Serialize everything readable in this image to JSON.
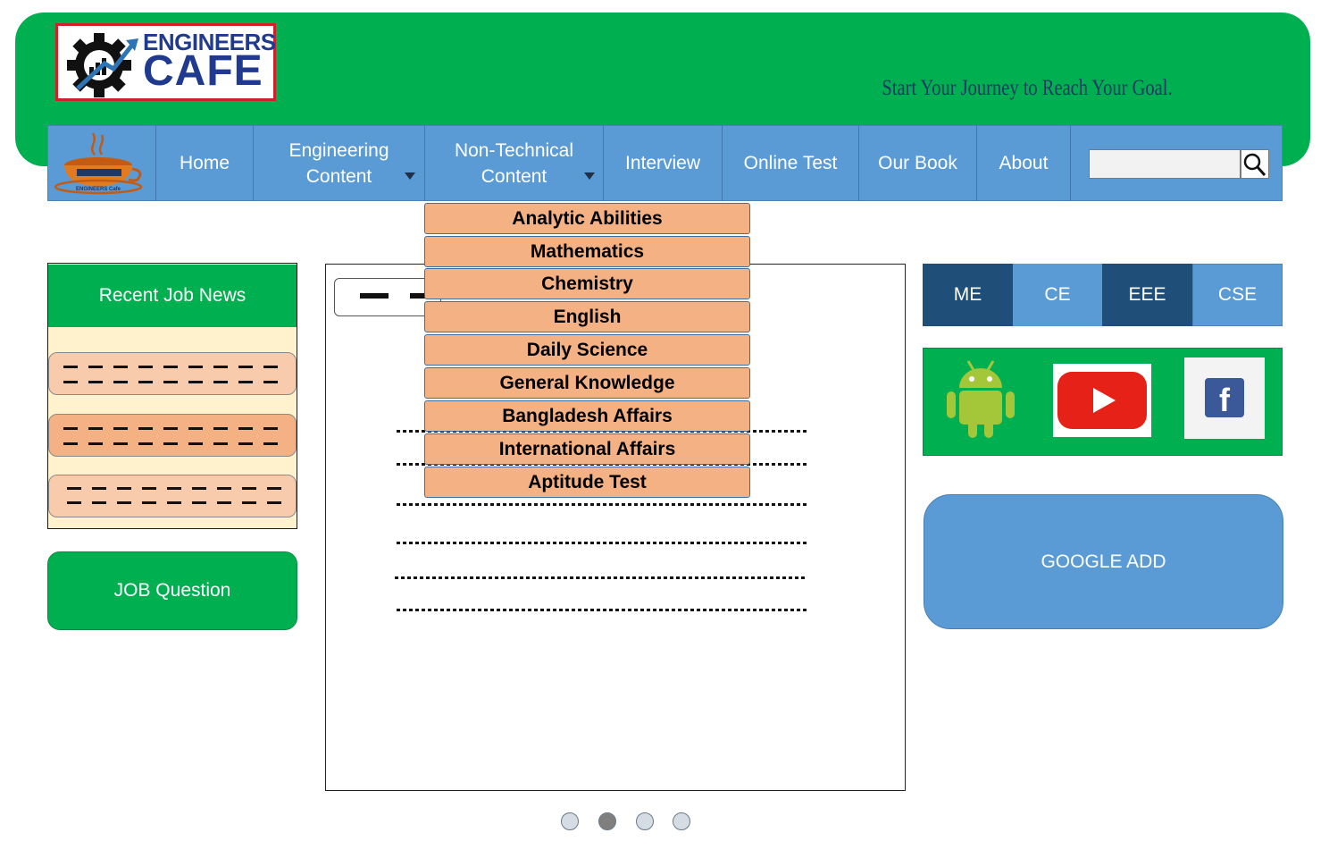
{
  "header": {
    "logo": {
      "line1": "ENGINEERS",
      "line2": "CAFE"
    },
    "tagline": "Start Your Journey to Reach Your Goal."
  },
  "nav": {
    "home": "Home",
    "engineering_content": "Engineering Content",
    "non_technical_content": "Non-Technical Content",
    "interview": "Interview",
    "online_test": "Online Test",
    "our_book": "Our Book",
    "about": "About",
    "search_placeholder": ""
  },
  "dropdown": {
    "items": [
      "Analytic Abilities",
      "Mathematics",
      "Chemistry",
      "English",
      "Daily Science",
      "General Knowledge",
      "Bangladesh Affairs",
      "International Affairs",
      "Aptitude Test"
    ]
  },
  "left": {
    "recent_job_news": "Recent Job News",
    "job_question": "JOB Question"
  },
  "right": {
    "branches": [
      "ME",
      "CE",
      "EEE",
      "CSE"
    ],
    "social_icons": [
      "android-icon",
      "youtube-icon",
      "facebook-icon"
    ],
    "google_ad": "GOOGLE ADD"
  },
  "pagination": {
    "count": 4,
    "active_index": 1
  },
  "colors": {
    "header_green": "#00b050",
    "nav_blue": "#5b9bd5",
    "dropdown_orange": "#f4b183",
    "dark_tab": "#1f4e79",
    "news_light": "#f8cbad",
    "news_dark": "#f4b183",
    "panel_cream": "#fff2cc"
  }
}
